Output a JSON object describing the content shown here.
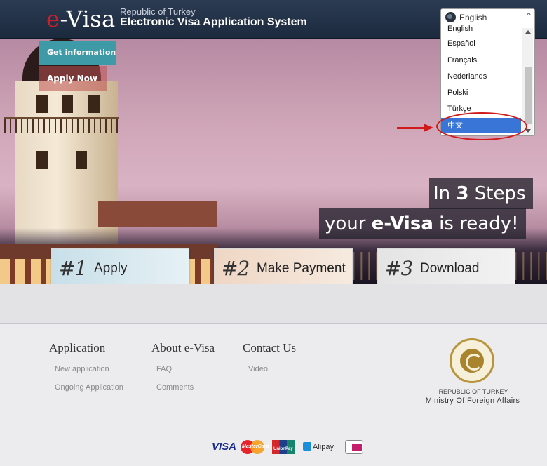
{
  "header": {
    "logo_e": "e",
    "logo_rest": "-Visa",
    "republic": "Republic of Turkey",
    "system_title": "Electronic Visa Application System"
  },
  "hero": {
    "get_information": "Get information",
    "apply_now": "Apply Now",
    "headline_line1_pre": "In ",
    "headline_line1_bold": "3",
    "headline_line1_post": " Steps",
    "headline_line2_pre": "your ",
    "headline_line2_bold": "e-Visa",
    "headline_line2_post": " is ready!"
  },
  "language": {
    "selected": "English",
    "options": [
      "English",
      "Español",
      "Français",
      "Nederlands",
      "Polski",
      "Türkçe",
      "中文"
    ],
    "highlighted": "中文"
  },
  "steps": [
    {
      "num": "#1",
      "label": "Apply"
    },
    {
      "num": "#2",
      "label": "Make Payment"
    },
    {
      "num": "#3",
      "label": "Download"
    }
  ],
  "footer": {
    "columns": [
      {
        "title": "Application",
        "links": [
          "New application",
          "Ongoing Application"
        ]
      },
      {
        "title": "About e-Visa",
        "links": [
          "FAQ",
          "Comments"
        ]
      },
      {
        "title": "Contact Us",
        "links": [
          "Video"
        ]
      }
    ],
    "republic_caps": "REPUBLIC OF TURKEY",
    "ministry": "Ministry Of Foreign Affairs"
  },
  "payments": {
    "visa": "VISA",
    "mastercard": "MasterCard",
    "unionpay": "UnionPay",
    "alipay": "Alipay",
    "ideal": "iDEAL"
  },
  "colors": {
    "header_bg": "#1c2a3e",
    "accent_teal": "#3d9aa6",
    "highlight_blue": "#3875d7",
    "annotation_red": "#d11a1a"
  }
}
